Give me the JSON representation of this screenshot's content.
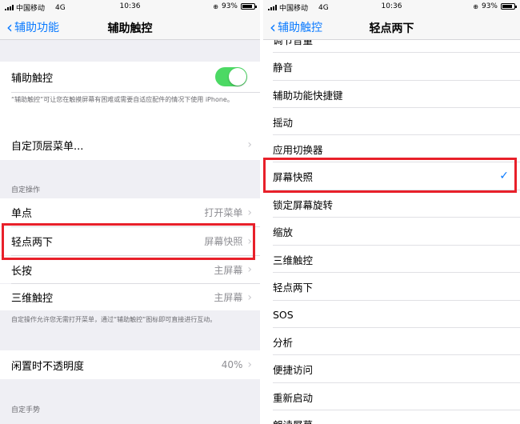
{
  "left": {
    "status": {
      "carrier": "中国移动",
      "network": "4G",
      "time": "10:36",
      "battery": "93%"
    },
    "nav": {
      "back_label": "辅助功能",
      "title": "辅助触控"
    },
    "assistive_touch": {
      "label": "辅助触控",
      "enabled": true
    },
    "assistive_note": "“辅助触控”可让您在触摸屏幕有困难或需要自适应配件的情况下使用 iPhone。",
    "customize_menu": {
      "label": "自定顶层菜单..."
    },
    "custom_actions_header": "自定操作",
    "actions": [
      {
        "label": "单点",
        "value": "打开菜单"
      },
      {
        "label": "轻点两下",
        "value": "屏幕快照"
      },
      {
        "label": "长按",
        "value": "主屏幕"
      },
      {
        "label": "三维触控",
        "value": "主屏幕"
      }
    ],
    "actions_note": "自定操作允许您无需打开菜单，通过“辅助触控”图标即可直接进行互动。",
    "idle_opacity": {
      "label": "闲置时不透明度",
      "value": "40%"
    },
    "custom_gestures_header": "自定手势"
  },
  "right": {
    "status": {
      "carrier": "中国移动",
      "network": "4G",
      "time": "10:36",
      "battery": "93%"
    },
    "nav": {
      "back_label": "辅助触控",
      "title": "轻点两下"
    },
    "partial_top": "调节音量",
    "items": [
      {
        "label": "静音"
      },
      {
        "label": "辅助功能快捷键"
      },
      {
        "label": "摇动"
      },
      {
        "label": "应用切换器"
      },
      {
        "label": "屏幕快照",
        "checked": true
      },
      {
        "label": "锁定屏幕旋转"
      },
      {
        "label": "缩放"
      },
      {
        "label": "三维触控"
      },
      {
        "label": "轻点两下"
      },
      {
        "label": "SOS"
      },
      {
        "label": "分析"
      },
      {
        "label": "便捷访问"
      },
      {
        "label": "重新启动"
      }
    ],
    "partial_bottom": "朗读屏幕"
  },
  "icons": {
    "back": "chevron-left-icon",
    "disclosure": "chevron-right-icon",
    "check": "checkmark-icon",
    "lock": "orientation-lock-icon"
  },
  "colors": {
    "accent": "#0a7aff",
    "toggle_on": "#4cd964",
    "highlight": "#e8202a"
  }
}
